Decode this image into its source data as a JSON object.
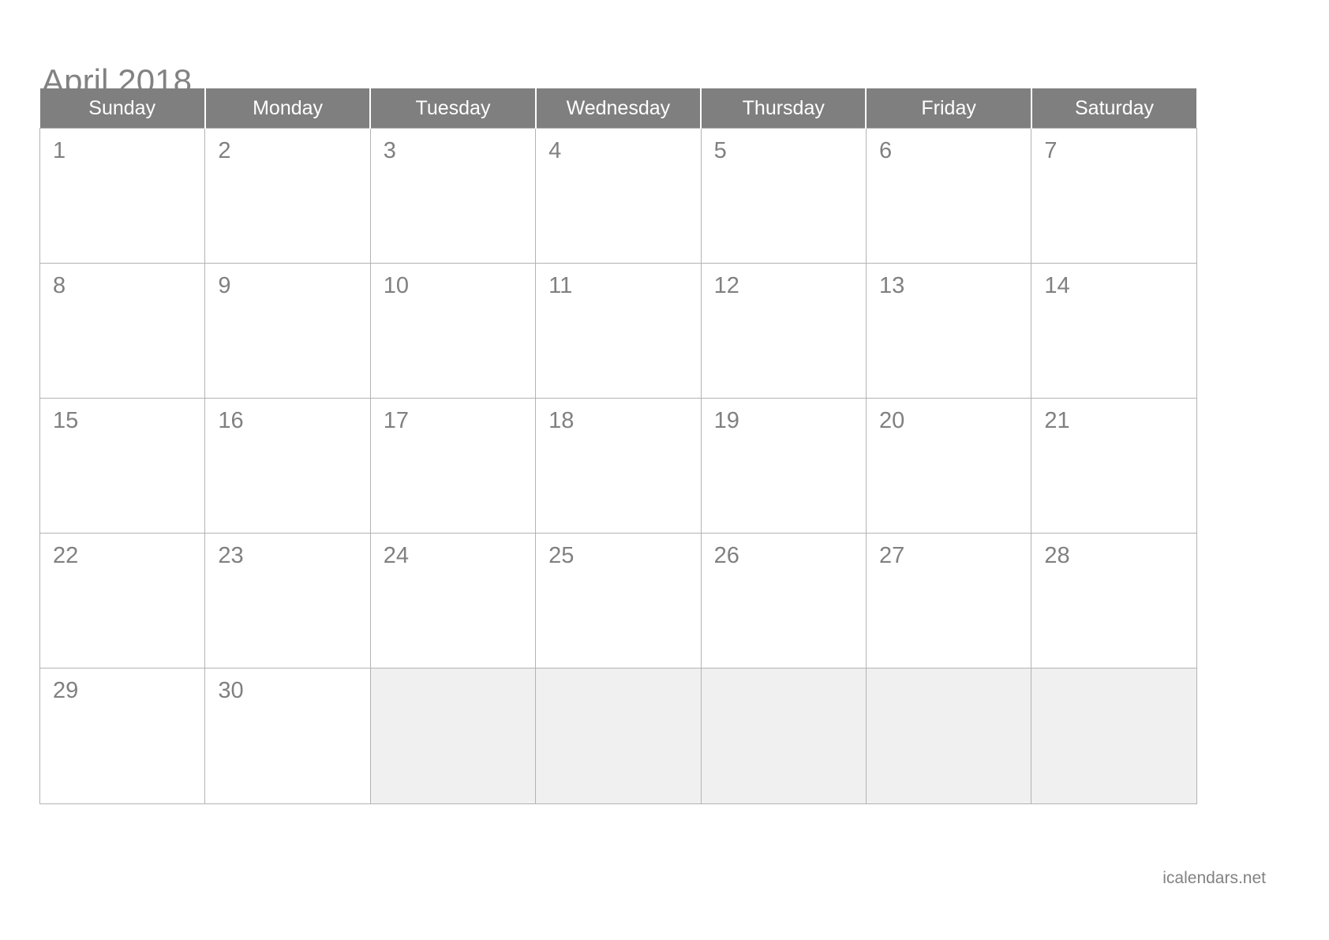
{
  "title": "April 2018",
  "month": "April",
  "year": "2018",
  "weekday_headers": [
    "Sunday",
    "Monday",
    "Tuesday",
    "Wednesday",
    "Thursday",
    "Friday",
    "Saturday"
  ],
  "weeks": [
    [
      {
        "day": "1",
        "blank": false
      },
      {
        "day": "2",
        "blank": false
      },
      {
        "day": "3",
        "blank": false
      },
      {
        "day": "4",
        "blank": false
      },
      {
        "day": "5",
        "blank": false
      },
      {
        "day": "6",
        "blank": false
      },
      {
        "day": "7",
        "blank": false
      }
    ],
    [
      {
        "day": "8",
        "blank": false
      },
      {
        "day": "9",
        "blank": false
      },
      {
        "day": "10",
        "blank": false
      },
      {
        "day": "11",
        "blank": false
      },
      {
        "day": "12",
        "blank": false
      },
      {
        "day": "13",
        "blank": false
      },
      {
        "day": "14",
        "blank": false
      }
    ],
    [
      {
        "day": "15",
        "blank": false
      },
      {
        "day": "16",
        "blank": false
      },
      {
        "day": "17",
        "blank": false
      },
      {
        "day": "18",
        "blank": false
      },
      {
        "day": "19",
        "blank": false
      },
      {
        "day": "20",
        "blank": false
      },
      {
        "day": "21",
        "blank": false
      }
    ],
    [
      {
        "day": "22",
        "blank": false
      },
      {
        "day": "23",
        "blank": false
      },
      {
        "day": "24",
        "blank": false
      },
      {
        "day": "25",
        "blank": false
      },
      {
        "day": "26",
        "blank": false
      },
      {
        "day": "27",
        "blank": false
      },
      {
        "day": "28",
        "blank": false
      }
    ],
    [
      {
        "day": "29",
        "blank": false
      },
      {
        "day": "30",
        "blank": false
      },
      {
        "day": "",
        "blank": true
      },
      {
        "day": "",
        "blank": true
      },
      {
        "day": "",
        "blank": true
      },
      {
        "day": "",
        "blank": true
      },
      {
        "day": "",
        "blank": true
      }
    ]
  ],
  "footer": {
    "watermark": "icalendars.net"
  },
  "colors": {
    "header_background": "#7f7f7f",
    "header_text": "#ffffff",
    "title_text": "#828282",
    "day_number_text": "#808080",
    "cell_background": "#ffffff",
    "blank_cell_background": "#f0f0f0",
    "cell_border": "#b3b3b3",
    "page_background": "#ffffff",
    "watermark_text": "#828282"
  }
}
